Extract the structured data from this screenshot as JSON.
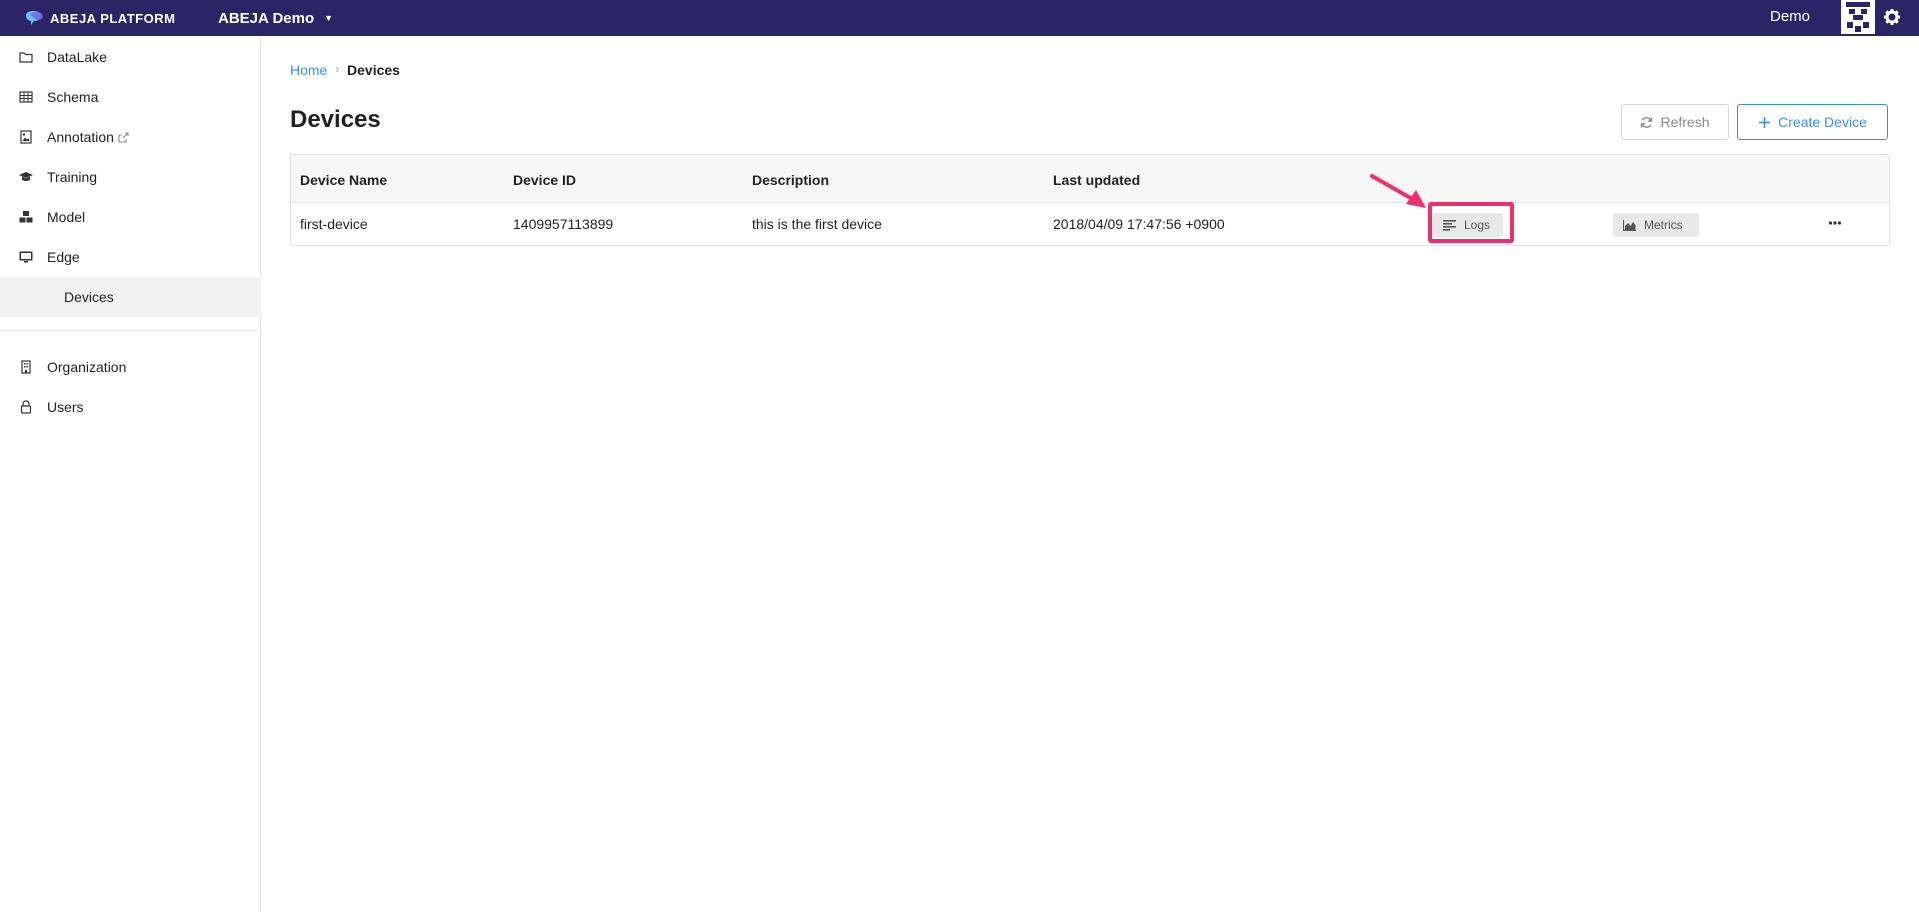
{
  "topbar": {
    "logo_text": "ABEJA PLATFORM",
    "org_name": "ABEJA Demo",
    "user_name": "Demo",
    "bg_color": "#2a2665"
  },
  "sidebar": {
    "items": [
      {
        "label": "DataLake",
        "icon": "folder-icon"
      },
      {
        "label": "Schema",
        "icon": "table-icon"
      },
      {
        "label": "Annotation",
        "icon": "image-icon",
        "external": true
      },
      {
        "label": "Training",
        "icon": "graduation-cap-icon"
      },
      {
        "label": "Model",
        "icon": "cubes-icon"
      },
      {
        "label": "Edge",
        "icon": "monitor-icon"
      },
      {
        "label": "Devices",
        "icon": "",
        "active": true
      },
      {
        "label": "Organization",
        "icon": "building-icon"
      },
      {
        "label": "Users",
        "icon": "lock-icon"
      }
    ]
  },
  "breadcrumb": {
    "home": "Home",
    "separator": "›",
    "current": "Devices"
  },
  "page": {
    "title": "Devices",
    "refresh_label": "Refresh",
    "create_label": "Create Device"
  },
  "table": {
    "columns": [
      "Device Name",
      "Device ID",
      "Description",
      "Last updated"
    ],
    "rows": [
      {
        "name": "first-device",
        "id": "1409957113899",
        "description": "this is the first device",
        "last_updated": "2018/04/09 17:47:56 +0900",
        "logs_label": "Logs",
        "metrics_label": "Metrics"
      }
    ]
  },
  "colors": {
    "accent": "#3d8fd9",
    "highlight": "#f0306c"
  }
}
